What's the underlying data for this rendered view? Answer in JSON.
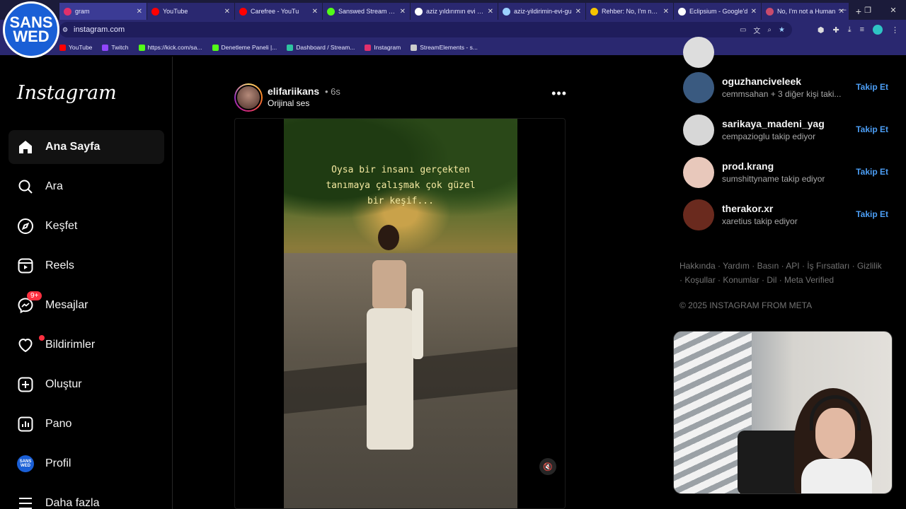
{
  "browser": {
    "tabs": [
      {
        "label": "gram",
        "color": "#e1306c",
        "active": true
      },
      {
        "label": "YouTube",
        "color": "#ff0000"
      },
      {
        "label": "Carefree - YouTu",
        "color": "#ff0000"
      },
      {
        "label": "Sanswed Stream - W",
        "color": "#53fc18"
      },
      {
        "label": "aziz yıldırımın evi - G",
        "color": "#ffffff"
      },
      {
        "label": "aziz-yildirimin-evi-gu",
        "color": "#9bd1ff"
      },
      {
        "label": "Rehber: No, I'm not a",
        "color": "#f5c400"
      },
      {
        "label": "Eclipsium - Google'd",
        "color": "#ffffff"
      },
      {
        "label": "No, I'm not a Human",
        "color": "#c84b6c"
      }
    ],
    "new_tab": "+",
    "url": "instagram.com",
    "bookmarks": [
      {
        "label": "YouTube",
        "color": "#ff0000"
      },
      {
        "label": "Twitch",
        "color": "#9146ff"
      },
      {
        "label": "https://kick.com/sa...",
        "color": "#53fc18"
      },
      {
        "label": "Denetleme Paneli |...",
        "color": "#53fc18"
      },
      {
        "label": "Dashboard / Stream...",
        "color": "#2ec4a0"
      },
      {
        "label": "Instagram",
        "color": "#e1306c"
      },
      {
        "label": "StreamElements - s...",
        "color": "#cccccc"
      }
    ],
    "badge_line1": "SANS",
    "badge_line2": "WED"
  },
  "sidebar": {
    "logo": "Instagram",
    "items": [
      {
        "label": "Ana Sayfa",
        "icon": "home-icon"
      },
      {
        "label": "Ara",
        "icon": "search-icon"
      },
      {
        "label": "Keşfet",
        "icon": "compass-icon"
      },
      {
        "label": "Reels",
        "icon": "reels-icon"
      },
      {
        "label": "Mesajlar",
        "icon": "messenger-icon",
        "badge": "9+"
      },
      {
        "label": "Bildirimler",
        "icon": "heart-icon"
      },
      {
        "label": "Oluştur",
        "icon": "plus-square-icon"
      },
      {
        "label": "Pano",
        "icon": "dashboard-icon"
      },
      {
        "label": "Profil",
        "icon": "avatar"
      },
      {
        "label": "Daha fazla",
        "icon": "menu-icon"
      }
    ],
    "profile_avatar_text": "SANS WED"
  },
  "post": {
    "username": "elifariikans",
    "time": "• 6s",
    "audio": "Orijinal ses",
    "caption_lines": [
      "Oysa bir insanı gerçekten",
      "tanımaya çalışmak çok güzel",
      "bir keşif..."
    ]
  },
  "suggestions": [
    {
      "username": "oguzhanciveleek",
      "sub": "cemmsahan + 3 diğer kişi taki...",
      "follow": "Takip Et",
      "color": "#3a5a80"
    },
    {
      "username": "sarikaya_madeni_yag",
      "sub": "cempazioglu takip ediyor",
      "follow": "Takip Et",
      "color": "#d7d7d7"
    },
    {
      "username": "prod.krang",
      "sub": "sumshittyname takip ediyor",
      "follow": "Takip Et",
      "color": "#e8c8bb"
    },
    {
      "username": "therakor.xr",
      "sub": "xaretius takip ediyor",
      "follow": "Takip Et",
      "color": "#6a2a1e"
    }
  ],
  "footer": {
    "links": "Hakkında · Yardım · Basın · API · İş Fırsatları · Gizlilik · Koşullar · Konumlar · Dil · Meta Verified",
    "copyright": "© 2025 INSTAGRAM FROM META"
  }
}
